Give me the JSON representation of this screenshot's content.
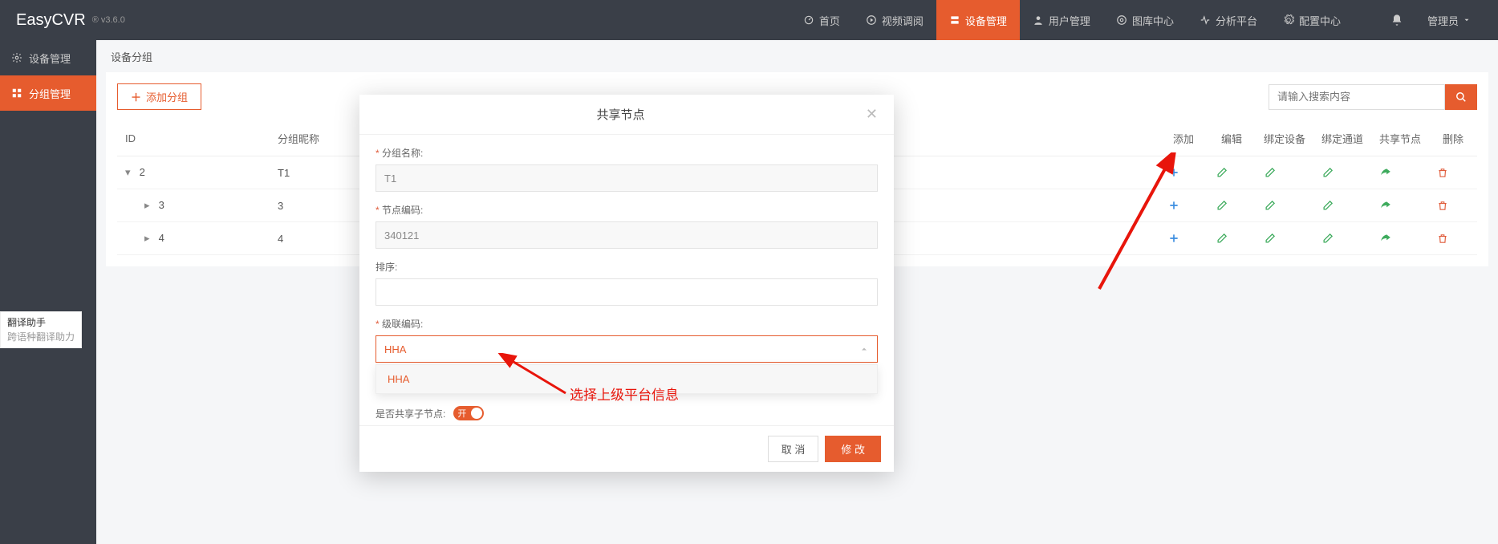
{
  "brand": "EasyCVR",
  "version": "® v3.6.0",
  "topnav": {
    "home": "首页",
    "video": "视频调阅",
    "device": "设备管理",
    "user": "用户管理",
    "gallery": "图库中心",
    "analysis": "分析平台",
    "config": "配置中心",
    "admin": "管理员"
  },
  "sidebar": {
    "device_mgmt": "设备管理",
    "group_mgmt": "分组管理"
  },
  "crumb": "设备分组",
  "toolbar": {
    "add_group": "添加分组",
    "search_ph": "请输入搜索内容"
  },
  "table": {
    "hd_id": "ID",
    "hd_name": "分组昵称",
    "hd_add": "添加",
    "hd_edit": "编辑",
    "hd_bind_dev": "绑定设备",
    "hd_bind_ch": "绑定通道",
    "hd_share": "共享节点",
    "hd_del": "删除",
    "rows": [
      {
        "id": "2",
        "name": "T1",
        "level": 0,
        "caret": "▾"
      },
      {
        "id": "3",
        "name": "3",
        "level": 1,
        "caret": "▸"
      },
      {
        "id": "4",
        "name": "4",
        "level": 1,
        "caret": "▸"
      }
    ]
  },
  "modal": {
    "title": "共享节点",
    "lbl_name": "分组名称:",
    "val_name": "T1",
    "lbl_code": "节点编码:",
    "val_code": "340121",
    "lbl_sort": "排序:",
    "val_sort": "",
    "lbl_cascade": "级联编码:",
    "val_cascade": "HHA",
    "opt_cascade": "HHA",
    "lbl_share_child": "是否共享子节点:",
    "toggle_txt": "开",
    "btn_cancel": "取 消",
    "btn_ok": "修 改"
  },
  "annotation": "选择上级平台信息",
  "translator": {
    "l1": "翻译助手",
    "l2": "跨语种翻译助力"
  }
}
